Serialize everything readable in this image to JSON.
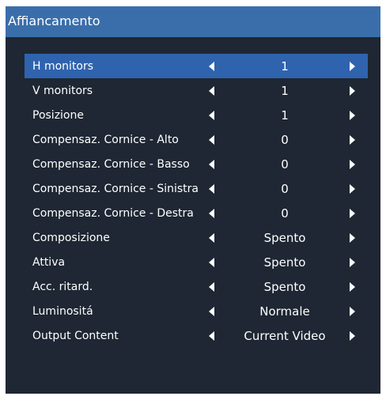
{
  "title": "Affiancamento",
  "colors": {
    "panel": "#1e2733",
    "titlebar": "#3a6eaa",
    "selected": "#2f63ae",
    "text": "#ffffff"
  },
  "icons": {
    "left": "triangle-left-icon",
    "right": "triangle-right-icon"
  },
  "selected_index": 0,
  "rows": [
    {
      "label": "H monitors",
      "value": "1"
    },
    {
      "label": "V monitors",
      "value": "1"
    },
    {
      "label": "Posizione",
      "value": "1"
    },
    {
      "label": "Compensaz. Cornice - Alto",
      "value": "0"
    },
    {
      "label": "Compensaz. Cornice - Basso",
      "value": "0"
    },
    {
      "label": "Compensaz. Cornice - Sinistra",
      "value": "0"
    },
    {
      "label": "Compensaz. Cornice - Destra",
      "value": "0"
    },
    {
      "label": "Composizione",
      "value": "Spento"
    },
    {
      "label": "Attiva",
      "value": "Spento"
    },
    {
      "label": "Acc. ritard.",
      "value": "Spento"
    },
    {
      "label": "Luminositá",
      "value": "Normale"
    },
    {
      "label": "Output Content",
      "value": "Current Video"
    }
  ]
}
